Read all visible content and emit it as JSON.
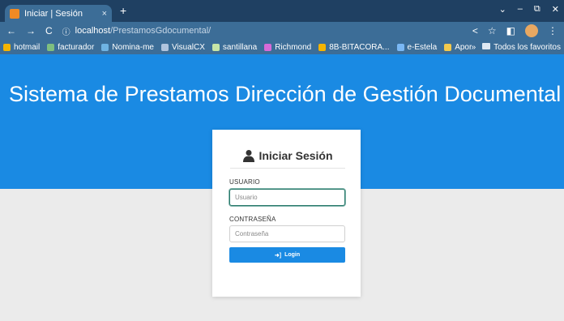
{
  "browser": {
    "tab_title": "Iniciar | Sesión",
    "tab_close": "×",
    "new_tab": "+",
    "window_controls": [
      "⌄",
      "–",
      "⧉",
      "✕"
    ],
    "url_host": "localhost",
    "url_path": "/PrestamosGdocumental/",
    "bookmarks": [
      {
        "label": "hotmail",
        "icon": "grid-icon",
        "color": "#f4b400"
      },
      {
        "label": "facturador",
        "icon": "arrow-icon",
        "color": "#7fbf7f"
      },
      {
        "label": "Nomina-me",
        "icon": "n-icon",
        "color": "#6fb3e3"
      },
      {
        "label": "VisualCX",
        "icon": "cx-icon",
        "color": "#b0c4de"
      },
      {
        "label": "santillana",
        "icon": "s-icon",
        "color": "#c7e6a7"
      },
      {
        "label": "Richmond",
        "icon": "z-icon",
        "color": "#d86ad8"
      },
      {
        "label": "8B-BITACORA...",
        "icon": "grid-icon",
        "color": "#f4b400"
      },
      {
        "label": "e-Estela",
        "icon": "e-icon",
        "color": "#7ab8f5"
      },
      {
        "label": "Aportes en lin...",
        "icon": "people-icon",
        "color": "#f2c94c"
      }
    ],
    "bookmarks_more": "»",
    "all_bookmarks": "Todos los favoritos"
  },
  "page": {
    "title": "Sistema de Prestamos Dirección de Gestión Documental"
  },
  "login": {
    "header": "Iniciar Sesión",
    "user_label": "USUARIO",
    "user_placeholder": "Usuario",
    "password_label": "CONTRASEÑA",
    "password_placeholder": "Contraseña",
    "button": "Login",
    "accent_color": "#1a8ae3"
  }
}
